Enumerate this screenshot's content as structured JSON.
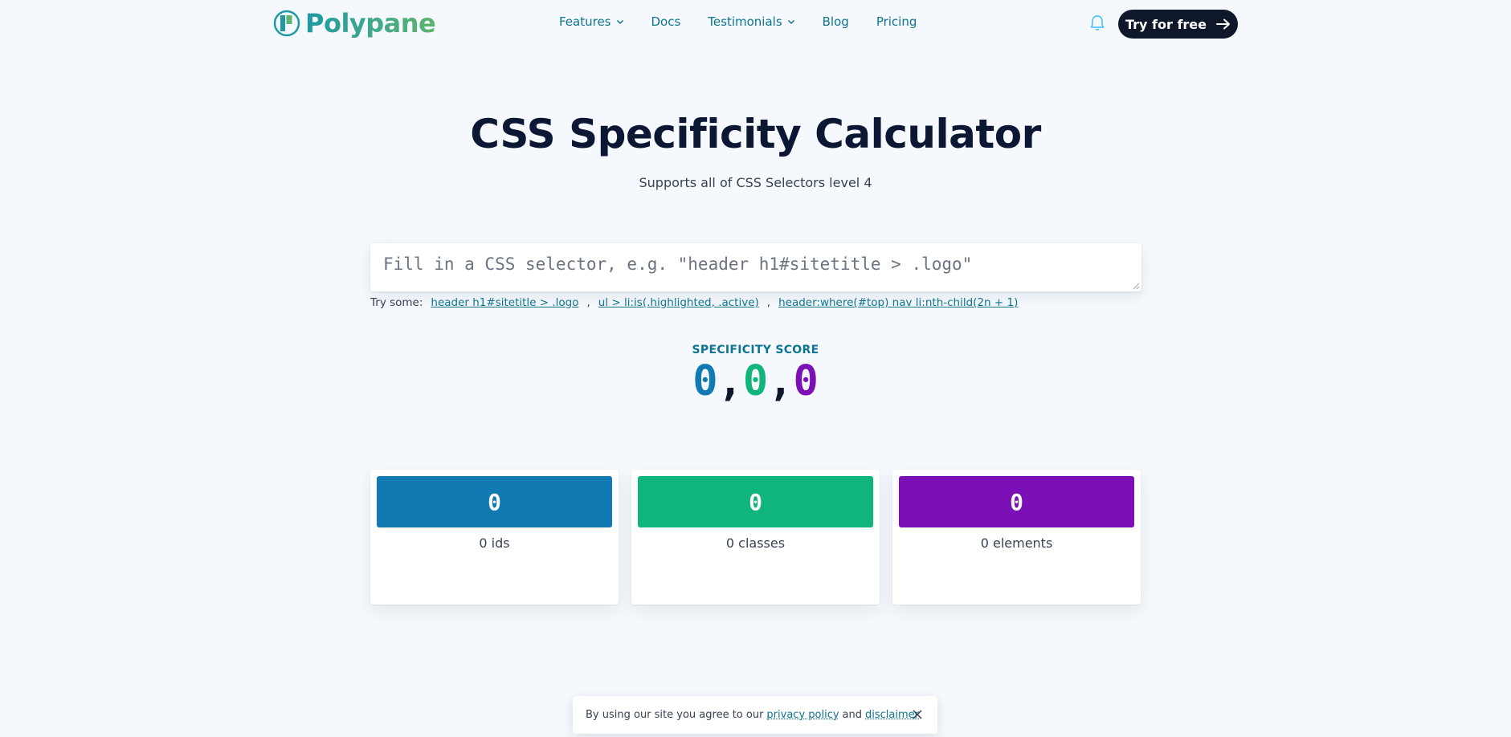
{
  "brand": {
    "name": "Polypane"
  },
  "nav": {
    "items": [
      {
        "label": "Features",
        "has_menu": true
      },
      {
        "label": "Docs",
        "has_menu": false
      },
      {
        "label": "Testimonials",
        "has_menu": true
      },
      {
        "label": "Blog",
        "has_menu": false
      },
      {
        "label": "Pricing",
        "has_menu": false
      }
    ],
    "cta_label": "Try for free",
    "icons": {
      "notifications": "bell-icon",
      "cta_arrow": "arrow-right-icon"
    }
  },
  "hero": {
    "title": "CSS Specificity Calculator",
    "subtitle": "Supports all of CSS Selectors level 4"
  },
  "input": {
    "value": "",
    "placeholder": "Fill in a CSS selector, e.g. \"header h1#sitetitle > .logo\""
  },
  "examples": {
    "label": "Try some:",
    "items": [
      "header h1#sitetitle > .logo",
      "ul > li:is(.highlighted, .active)",
      "header:where(#top) nav li:nth-child(2n + 1)"
    ]
  },
  "score": {
    "label": "SPECIFICITY SCORE",
    "ids": "0",
    "classes": "0",
    "elements": "0",
    "separator": ","
  },
  "cards": [
    {
      "value": "0",
      "caption": "0 ids",
      "color": "#117ab3"
    },
    {
      "value": "0",
      "caption": "0 classes",
      "color": "#10b57b"
    },
    {
      "value": "0",
      "caption": "0 elements",
      "color": "#7a10b5"
    }
  ],
  "cookie": {
    "text_before": "By using our site you agree to our",
    "privacy_link": "privacy policy",
    "and": "and",
    "disclaimer_link": "disclaimer"
  },
  "colors": {
    "ids": "#117ab3",
    "classes": "#10b57b",
    "elements": "#7a10b5",
    "accent": "#0e7490",
    "dark": "#0f172a"
  }
}
